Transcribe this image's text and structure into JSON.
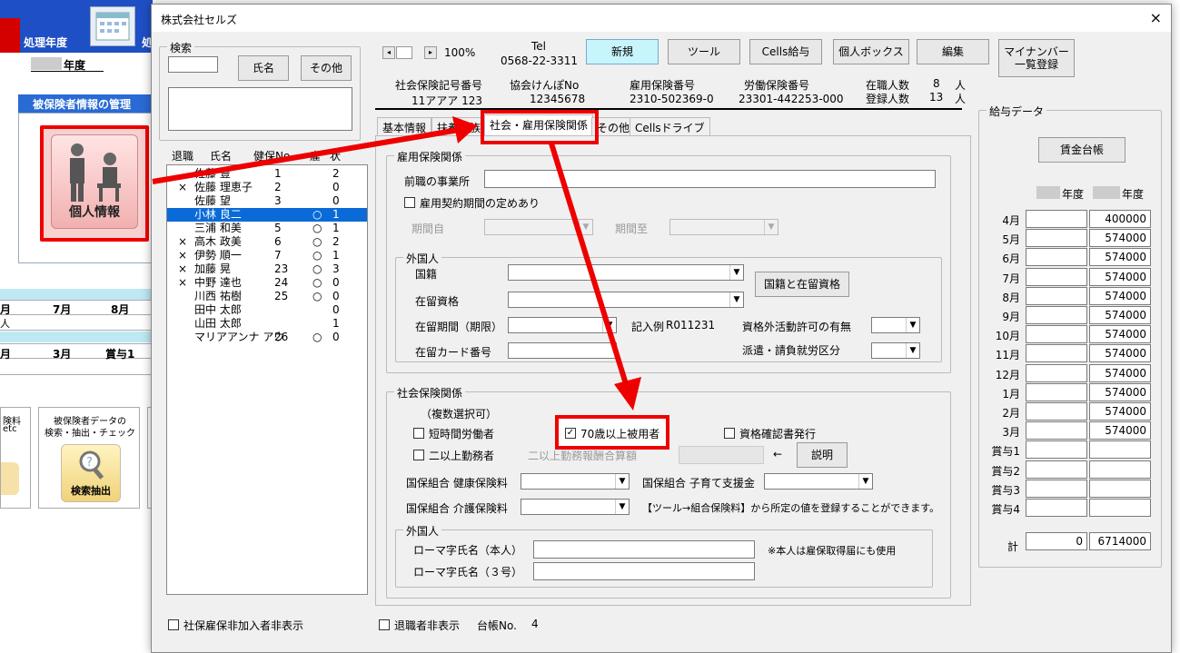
{
  "background_app": {
    "processing_year_label": "処理年度",
    "processing_year_label2": "処",
    "year_suffix": "年度",
    "panel_title": "被保険者情報の管理",
    "personal_info_label": "個人情報",
    "grid_row1": [
      "月",
      "7月",
      "8月"
    ],
    "grid_row1_sub": "人",
    "grid_row2": [
      "月",
      "3月",
      "賞与1"
    ],
    "card_left_text": [
      "険料",
      "etc"
    ],
    "card_search_title": "被保険者データの",
    "card_search_title2": "検索・抽出・チェック",
    "card_search_label": "検索抽出"
  },
  "dialog": {
    "title": "株式会社セルズ",
    "close": "×",
    "search": {
      "legend": "検索",
      "name_button": "氏名",
      "other_button": "その他"
    },
    "nav": {
      "prev": "◂",
      "next": "▸",
      "zoom": "100%"
    },
    "tel_label": "Tel",
    "tel_value": "0568-22-3311",
    "toolbar": [
      "新規",
      "ツール",
      "Cells給与",
      "個人ボックス",
      "編集",
      "マイナンバー\n一覧登録"
    ],
    "company_info": {
      "shaho_label": "社会保険記号番号",
      "shaho_value": "11アアア 123",
      "kyokai_label": "協会けんぽNo",
      "kyokai_value": "12345678",
      "koyo_label": "雇用保険番号",
      "koyo_value": "2310-502369-0",
      "rodo_label": "労働保険番号",
      "rodo_value": "23301-442253-000",
      "active_label": "在職人数",
      "active_value": "8",
      "registered_label": "登録人数",
      "registered_value": "13",
      "unit": "人"
    },
    "list_header": {
      "retired": "退職",
      "name": "氏名",
      "kenpo": "健保No",
      "col4": "雇",
      "col5": "状"
    },
    "employees": [
      {
        "mark": "",
        "name": "佐藤 豊",
        "no": "1",
        "koyo": "",
        "flag": "2"
      },
      {
        "mark": "×",
        "name": "佐藤 理恵子",
        "no": "2",
        "koyo": "",
        "flag": "0"
      },
      {
        "mark": "",
        "name": "佐藤 望",
        "no": "3",
        "koyo": "",
        "flag": "0"
      },
      {
        "mark": "",
        "name": "小林 良二",
        "no": "",
        "koyo": "○",
        "flag": "1"
      },
      {
        "mark": "",
        "name": "三浦 和美",
        "no": "5",
        "koyo": "○",
        "flag": "1"
      },
      {
        "mark": "×",
        "name": "高木 政美",
        "no": "6",
        "koyo": "○",
        "flag": "2"
      },
      {
        "mark": "×",
        "name": "伊勢 順一",
        "no": "7",
        "koyo": "○",
        "flag": "1"
      },
      {
        "mark": "×",
        "name": "加藤 晃",
        "no": "23",
        "koyo": "○",
        "flag": "3"
      },
      {
        "mark": "×",
        "name": "中野 達也",
        "no": "24",
        "koyo": "○",
        "flag": "0"
      },
      {
        "mark": "",
        "name": "川西 祐樹",
        "no": "25",
        "koyo": "○",
        "flag": "0"
      },
      {
        "mark": "",
        "name": "田中 太郎",
        "no": "",
        "koyo": "",
        "flag": "0"
      },
      {
        "mark": "",
        "name": "山田 太郎",
        "no": "",
        "koyo": "",
        "flag": "1"
      },
      {
        "mark": "",
        "name": "マリアアンナ アウ",
        "no": "26",
        "koyo": "○",
        "flag": "0"
      }
    ],
    "selected_index": 3,
    "tabs": [
      "基本情報",
      "扶養家族",
      "社会・雇用保険関係",
      "その他",
      "Cellsドライブ"
    ],
    "active_tab": 2,
    "koyo_section": {
      "legend": "雇用保険関係",
      "prev_office_label": "前職の事業所",
      "contract_label": "雇用契約期間の定めあり",
      "period_from_label": "期間自",
      "period_to_label": "期間至"
    },
    "foreigner_section": {
      "legend": "外国人",
      "nationality_label": "国籍",
      "status_label": "在留資格",
      "nat_status_button": "国籍と在留資格",
      "period_label": "在留期間（期限）",
      "example_label": "記入例",
      "example_value": "R011231",
      "outside_activity_label": "資格外活動許可の有無",
      "card_no_label": "在留カード番号",
      "dispatch_label": "派遣・請負就労区分"
    },
    "shaho_section": {
      "legend": "社会保険関係",
      "multi_note": "（複数選択可）",
      "short_time_label": "短時間労働者",
      "over70_label": "70歳以上被用者",
      "over70_checked": "✓",
      "qualification_label": "資格確認書発行",
      "multi_office_label": "二以上勤務者",
      "multi_office_sum_label": "二以上勤務報酬合算額",
      "arrow": "←",
      "explain_button": "説明",
      "kokuho_health_label": "国保組合 健康保険料",
      "kokuho_child_label": "国保組合 子育て支援金",
      "kokuho_care_label": "国保組合 介護保険料",
      "tool_note": "【ツール→組合保険料】から所定の値を登録することができます。"
    },
    "foreigner2_section": {
      "legend": "外国人",
      "romaji_self_label": "ローマ字氏名（本人）",
      "romaji_self_note": "※本人は雇保取得届にも使用",
      "romaji_3_label": "ローマ字氏名（３号）"
    },
    "salary": {
      "legend": "給与データ",
      "ledger_button": "賃金台帳",
      "year_suffix1": "年度",
      "year_suffix2": "年度",
      "rows": [
        {
          "label": "4月",
          "a": "",
          "b": "400000"
        },
        {
          "label": "5月",
          "a": "",
          "b": "574000"
        },
        {
          "label": "6月",
          "a": "",
          "b": "574000"
        },
        {
          "label": "7月",
          "a": "",
          "b": "574000"
        },
        {
          "label": "8月",
          "a": "",
          "b": "574000"
        },
        {
          "label": "9月",
          "a": "",
          "b": "574000"
        },
        {
          "label": "10月",
          "a": "",
          "b": "574000"
        },
        {
          "label": "11月",
          "a": "",
          "b": "574000"
        },
        {
          "label": "12月",
          "a": "",
          "b": "574000"
        },
        {
          "label": "1月",
          "a": "",
          "b": "574000"
        },
        {
          "label": "2月",
          "a": "",
          "b": "574000"
        },
        {
          "label": "3月",
          "a": "",
          "b": "574000"
        },
        {
          "label": "賞与1",
          "a": "",
          "b": ""
        },
        {
          "label": "賞与2",
          "a": "",
          "b": ""
        },
        {
          "label": "賞与3",
          "a": "",
          "b": ""
        },
        {
          "label": "賞与4",
          "a": "",
          "b": ""
        }
      ],
      "total_label": "計",
      "total_a": "0",
      "total_b": "6714000"
    },
    "footer": {
      "hide_non_shaho_label": "社保雇保非加入者非表示",
      "hide_retired_label": "退職者非表示",
      "ledger_no_label": "台帳No.",
      "ledger_no_value": "4"
    }
  },
  "colors": {
    "accent_red": "#e00000",
    "selection_blue": "#0a6ad8",
    "new_button": "#c8f4fc"
  }
}
